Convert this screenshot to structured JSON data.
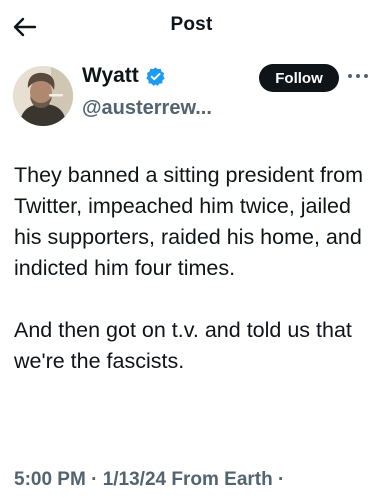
{
  "header": {
    "title": "Post",
    "back_icon": "arrow-left-icon"
  },
  "author": {
    "display_name": "Wyatt",
    "handle": "@austerrew...",
    "verified_icon": "verified-badge-icon",
    "verified_color": "#1d9bf0"
  },
  "actions": {
    "follow_label": "Follow",
    "more_icon": "more-dots-icon"
  },
  "post": {
    "paragraphs": [
      "They banned a sitting president from Twitter, impeached him twice, jailed his supporters, raided his home, and indicted him four times.",
      "And then got on t.v. and told us that we're the fascists."
    ],
    "meta": "5:00 PM · 1/13/24 From Earth ·"
  },
  "colors": {
    "text": "#0f1419",
    "secondary_text": "#536471",
    "follow_button": "#0f1419"
  }
}
